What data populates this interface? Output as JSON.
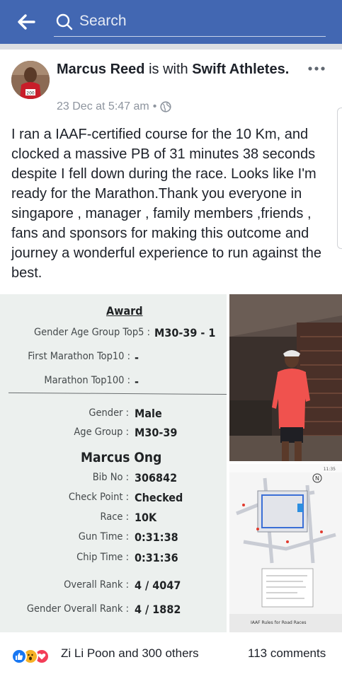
{
  "header": {
    "search_placeholder": "Search",
    "back_icon": "arrow-left-icon",
    "search_icon": "magnifier-icon",
    "bar_color": "#4267b2"
  },
  "post": {
    "author": "Marcus Reed",
    "with_text": "is with",
    "group": "Swift Athletes.",
    "timestamp": "23 Dec at 5:47 am",
    "separator": "•",
    "privacy_icon": "globe-icon",
    "more_icon": "ellipsis-icon",
    "text": "I ran a IAAF-certified course for the 10 Km, and clocked a massive PB of 31 minutes 38 seconds despite I fell down during the race. Looks like I'm ready for the Marathon.Thank you everyone in singapore , manager , family members ,friends , fans and sponsors for making this outcome and journey a wonderful experience to run against the best."
  },
  "result_slip": {
    "heading": "Award",
    "award_rows": [
      {
        "label": "Gender Age Group Top5 :",
        "value": "M30-39 - 1"
      },
      {
        "label": "First Marathon Top10 :",
        "value": "-"
      },
      {
        "label": "Marathon Top100 :",
        "value": "-"
      }
    ],
    "info_rows": [
      {
        "label": "Gender :",
        "value": "Male"
      },
      {
        "label": "Age Group :",
        "value": "M30-39"
      }
    ],
    "runner_name": "Marcus Ong",
    "detail_rows": [
      {
        "label": "Bib No :",
        "value": "306842"
      },
      {
        "label": "Check Point :",
        "value": "Checked"
      },
      {
        "label": "Race :",
        "value": "10K"
      },
      {
        "label": "Gun Time :",
        "value": "0:31:38"
      },
      {
        "label": "Chip Time :",
        "value": "0:31:36"
      },
      {
        "label": "Overall Rank :",
        "value": "4 / 4047"
      },
      {
        "label": "Gender Overall Rank :",
        "value": "4 / 1882"
      }
    ]
  },
  "map_image": {
    "status_time": "11:35",
    "footer_caption": "IAAF Rules for Road Races"
  },
  "footer": {
    "reactions_text": "Zi Li Poon and 300 others",
    "comments_text": "113 comments",
    "reaction_icons": [
      "like-icon",
      "wow-icon",
      "love-icon"
    ],
    "like_color": "#1877f2",
    "love_color": "#f33e58",
    "wow_color": "#f7b125"
  }
}
